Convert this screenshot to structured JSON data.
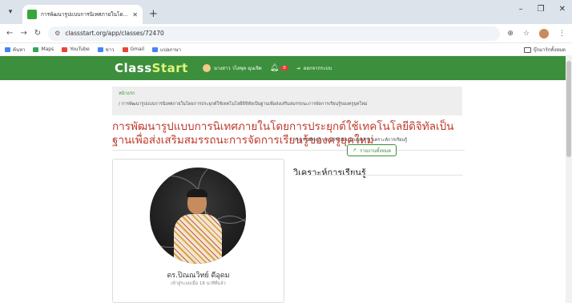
{
  "browser": {
    "tab_title": "การพัฒนารูปแบบการนิเทศภายในโด...",
    "url": "classstart.org/app/classes/72470",
    "bookmarks": [
      {
        "label": "ค้นหา",
        "color": "#4285f4"
      },
      {
        "label": "Maps",
        "color": "#34a853"
      },
      {
        "label": "YouTube",
        "color": "#ea4335"
      },
      {
        "label": "ข่าว",
        "color": "#4285f4"
      },
      {
        "label": "Gmail",
        "color": "#ea4335"
      },
      {
        "label": "แปลภาษา",
        "color": "#4285f4"
      }
    ],
    "bookmark_folder": "บุ๊กมาร์กทั้งหมด"
  },
  "navbar": {
    "brand_left": "Class",
    "brand_right": "Start",
    "user_name": "นางสาว วไลพุล ฉุนเจิด",
    "notif_count": "0",
    "logout_label": "ออกจากระบบ",
    "bg_color": "#3c8f3c"
  },
  "breadcrumb": {
    "home": "หน้าแรก",
    "current": "/ การพัฒนารูปแบบการนิเทศภายในโดยการประยุกต์ใช้เทคโนโลยีดิจิทัลเป็นฐานเพื่อส่งเสริมสมรรถนะการจัดการเรียนรู้ของครูยุคใหม่"
  },
  "page_title": "การพัฒนารูปแบบการนิเทศภายในโดยการประยุกต์ใช้เทคโนโลยีดิจิทัลเป็นฐานเพื่อส่งเสริมสมรรถนะการจัดการเรียนรู้ของครูยุคใหม่",
  "profile": {
    "name": "ดร.ปิณณวิทย์ ดีอุดม",
    "subtitle": "เข้าสู่ระบบเมื่อ 18 นาทีที่แล้ว"
  },
  "learning_analytics": {
    "title": "วิเคราะห์การเรียนรู้",
    "description": "กรุณารอสักครู่ ระบบกำลังประมวลผลการวิเคราะห์การเรียนรู้",
    "button_label": "รายงานทั้งหมด"
  }
}
